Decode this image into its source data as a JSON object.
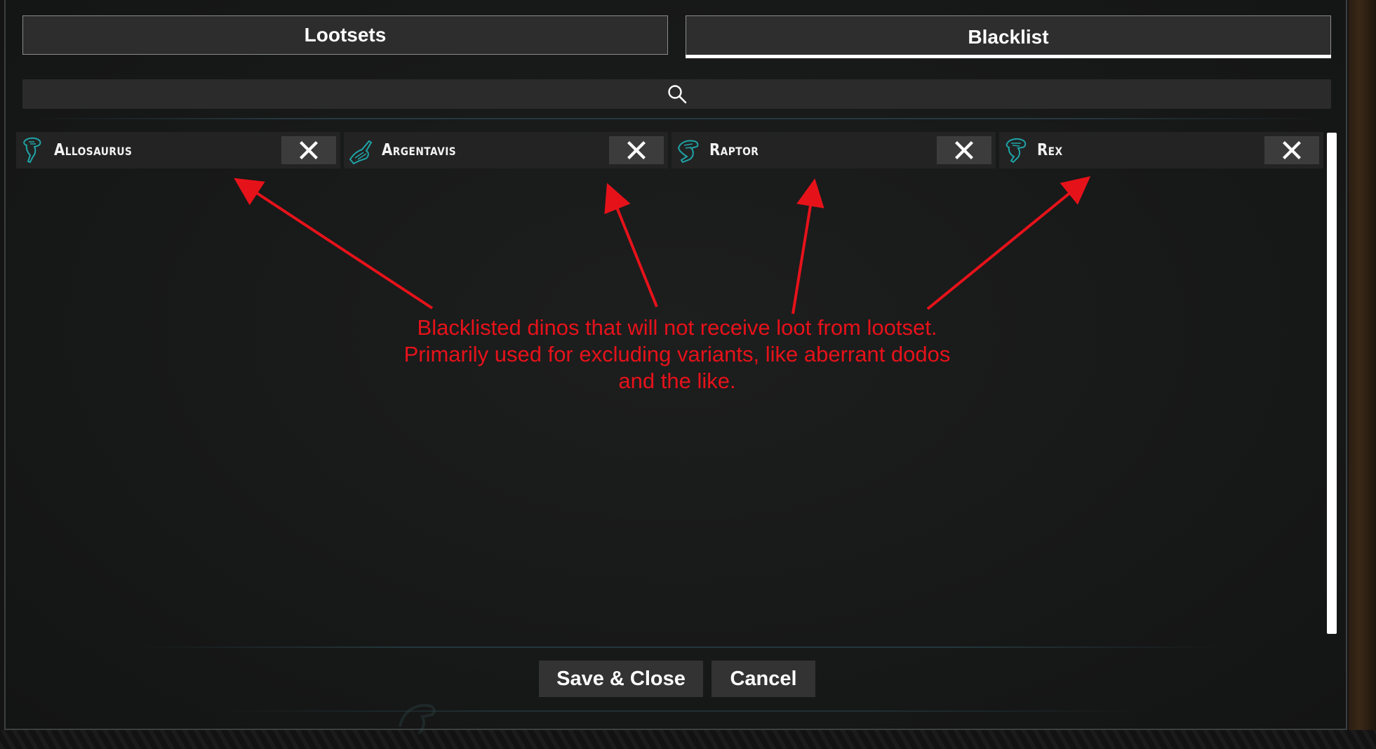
{
  "tabs": {
    "lootsets_label": "Lootsets",
    "blacklist_label": "Blacklist",
    "active": "Blacklist"
  },
  "search": {
    "icon": "search-icon",
    "value": ""
  },
  "blacklist": {
    "entries": [
      {
        "name": "Allosaurus",
        "icon": "dino-head-icon",
        "remove_icon": "close-icon"
      },
      {
        "name": "Argentavis",
        "icon": "bird-icon",
        "remove_icon": "close-icon"
      },
      {
        "name": "Raptor",
        "icon": "dino-head-icon",
        "remove_icon": "close-icon"
      },
      {
        "name": "Rex",
        "icon": "dino-head-icon",
        "remove_icon": "close-icon"
      }
    ]
  },
  "annotation": {
    "text": "Blacklisted dinos that will not receive loot from lootset. Primarily used for excluding variants, like aberrant dodos and the like.",
    "color": "#e6121a"
  },
  "footer": {
    "save_label": "Save & Close",
    "cancel_label": "Cancel"
  },
  "colors": {
    "panel_bg": "#181818",
    "entry_bg": "#232323",
    "icon_teal": "#1fa3a6",
    "accent_white": "#ffffff"
  }
}
